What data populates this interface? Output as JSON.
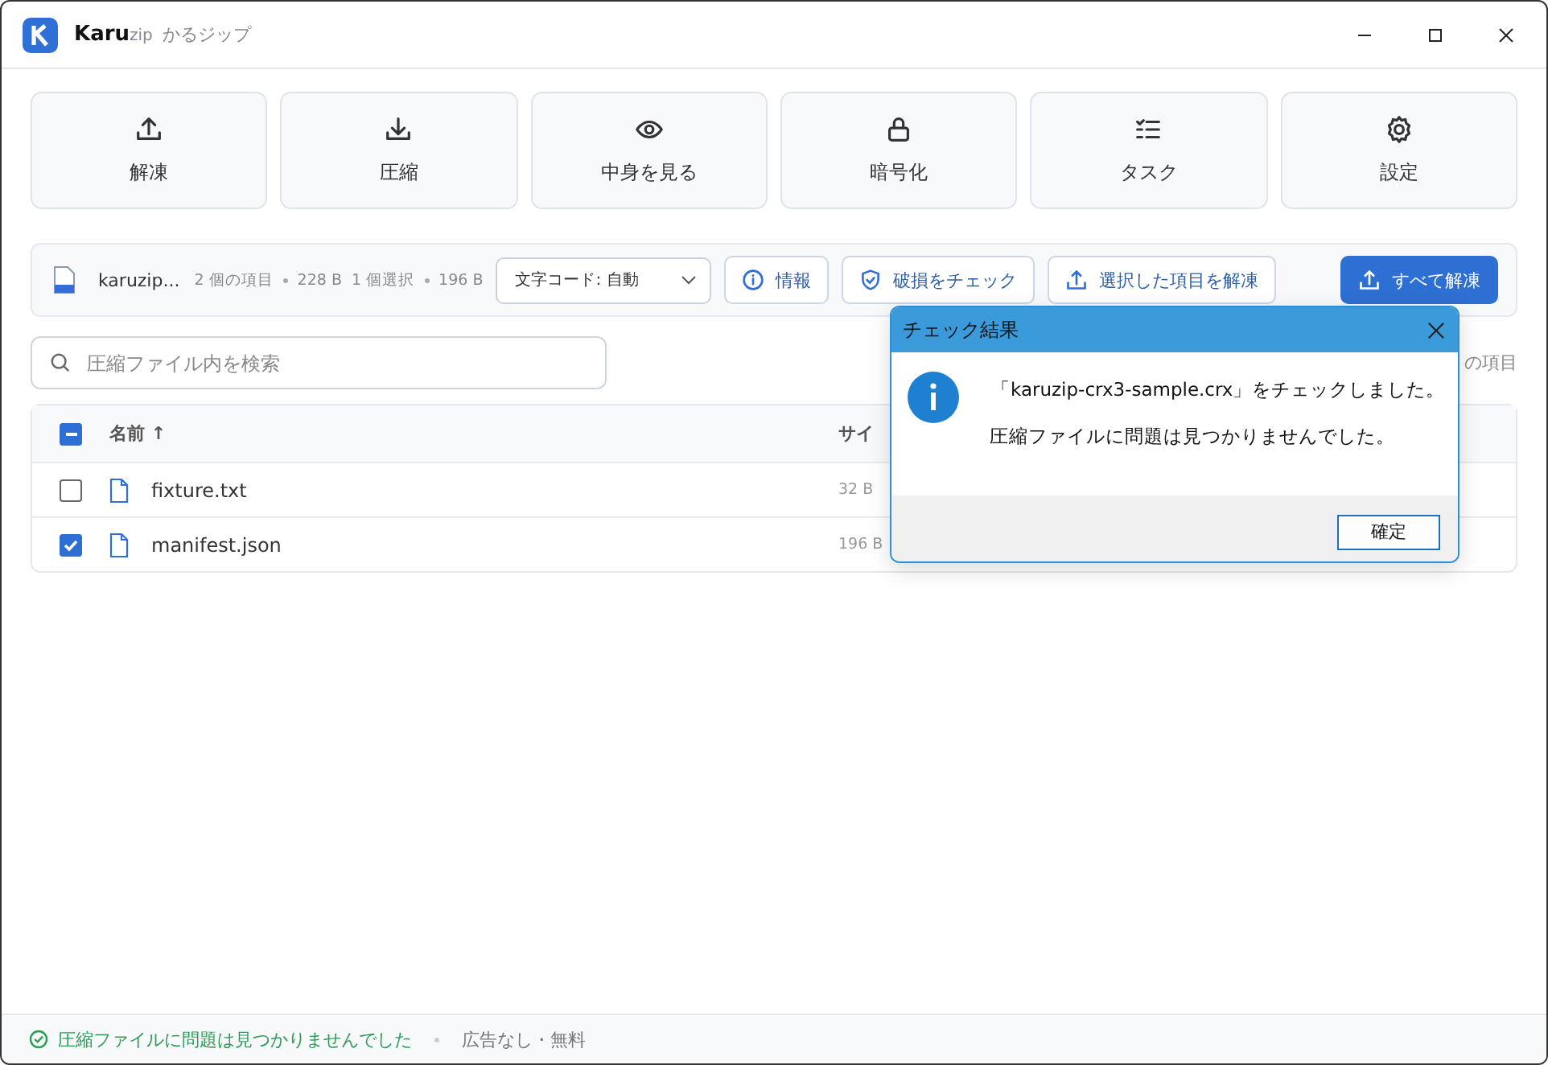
{
  "window": {
    "brand": "Karu",
    "brand_suffix": "zip",
    "subtitle": "かるジップ"
  },
  "toolbar": [
    {
      "label": "解凍"
    },
    {
      "label": "圧縮"
    },
    {
      "label": "中身を見る"
    },
    {
      "label": "暗号化"
    },
    {
      "label": "タスク"
    },
    {
      "label": "設定"
    }
  ],
  "archive_bar": {
    "file_name": "karuzip...",
    "item_count": "2 個の項目",
    "total_size": "228 B",
    "selected_count": "1 個選択",
    "selected_size": "196 B",
    "encoding": "文字コード: 自動",
    "buttons": [
      {
        "label": "情報",
        "primary": false
      },
      {
        "label": "破損をチェック",
        "primary": false
      },
      {
        "label": "選択した項目を解凍",
        "primary": false
      },
      {
        "label": "すべて解凍",
        "primary": true
      }
    ]
  },
  "search": {
    "placeholder": "圧縮ファイル内を検索"
  },
  "item_count_label": "の項目",
  "table": {
    "indeterminate": true,
    "columns": [
      "名前 ↑",
      "サイ"
    ],
    "rows": [
      {
        "name": "fixture.txt",
        "size": "32 B",
        "checked": false
      },
      {
        "name": "manifest.json",
        "size": "196 B",
        "checked": true
      }
    ]
  },
  "dialog": {
    "title": "チェック結果",
    "message": "「karuzip-crx3-sample.crx」をチェックしました。",
    "detail": "圧縮ファイルに問題は見つかりませんでした。",
    "ok": "確定"
  },
  "status_bar": {
    "message": "圧縮ファイルに問題は見つかりませんでした",
    "note": "広告なし・無料"
  }
}
